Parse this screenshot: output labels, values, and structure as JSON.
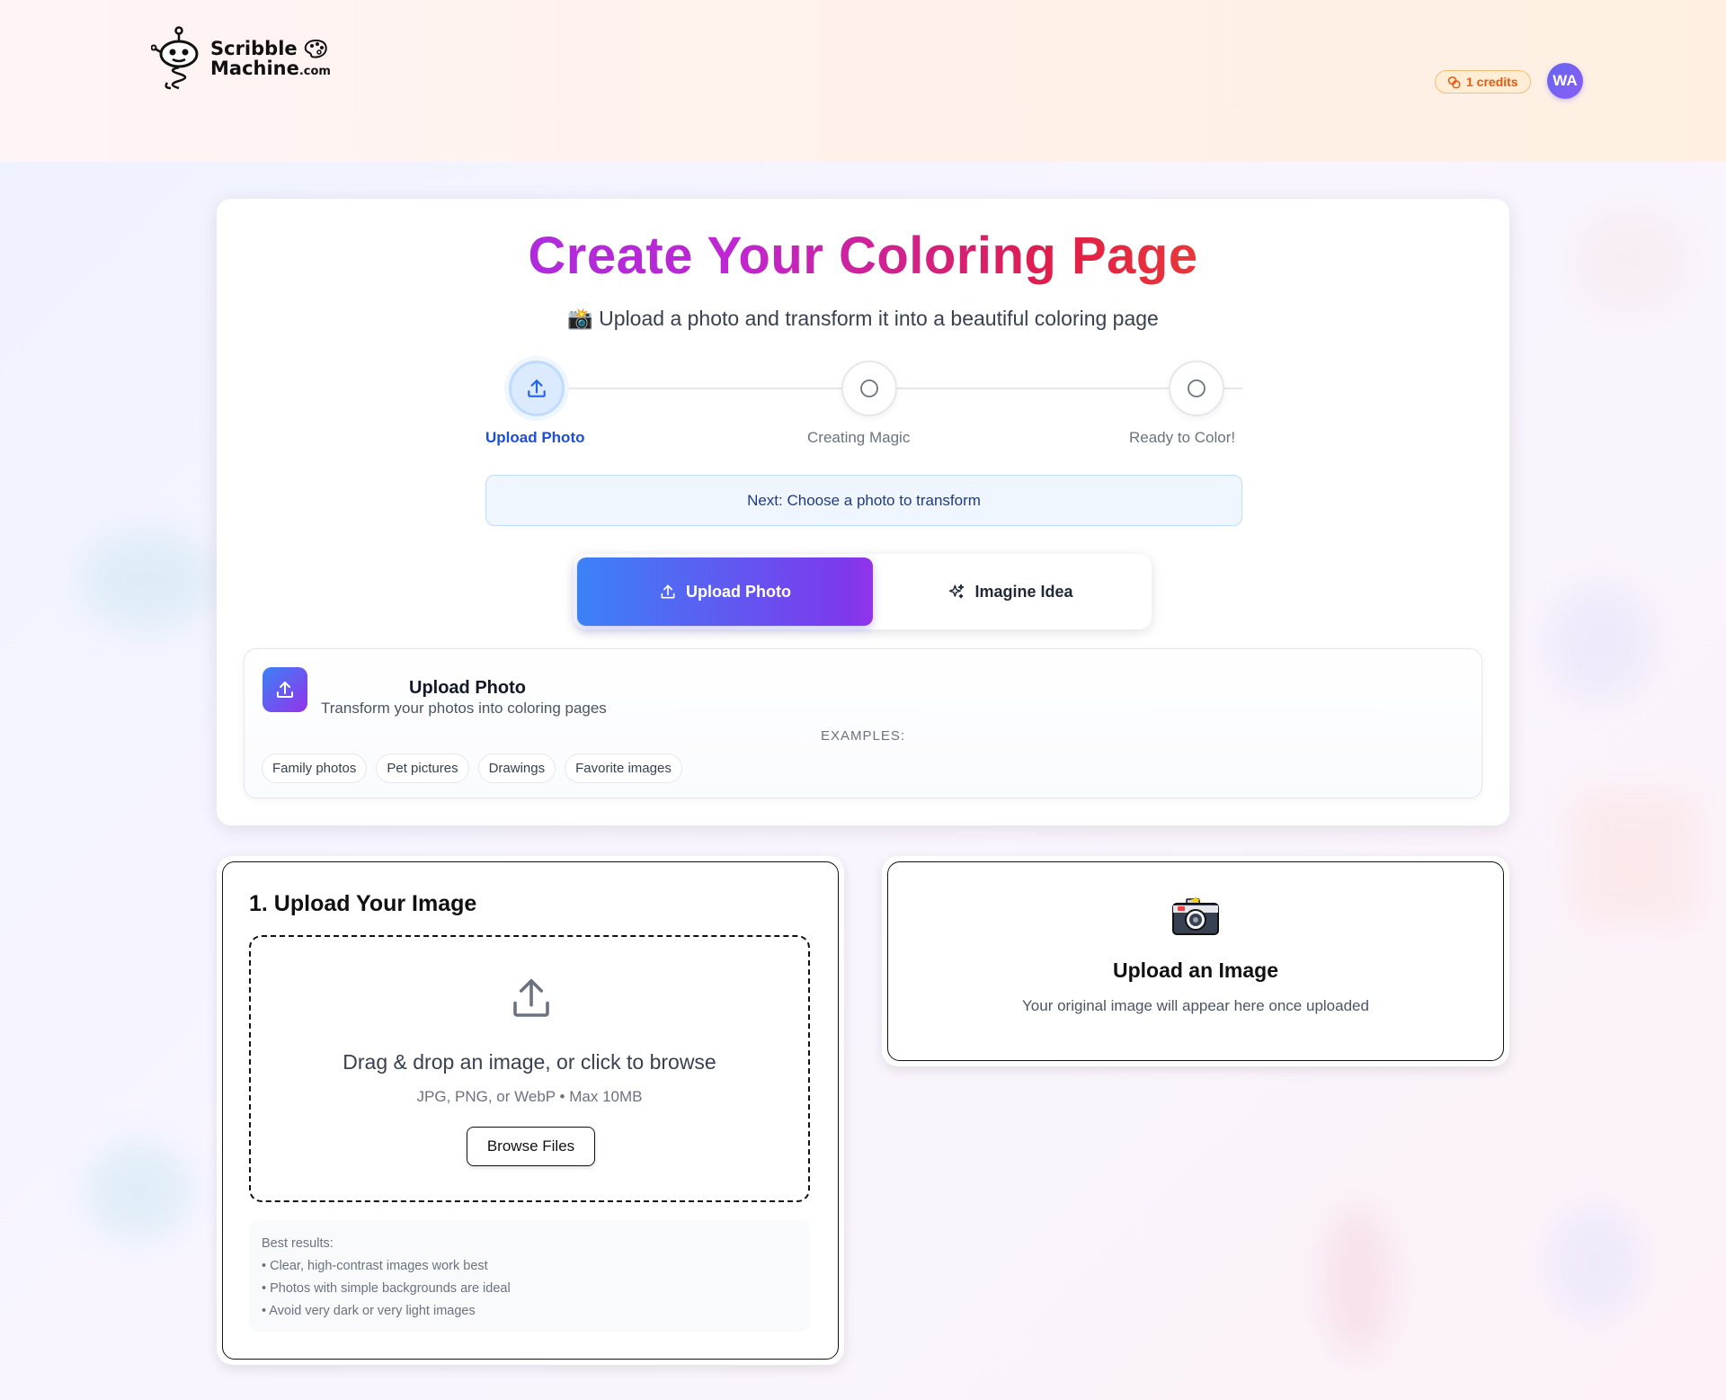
{
  "header": {
    "logo_line1": "Scribble",
    "logo_line2": "Machine",
    "logo_suffix": ".com",
    "credits": "1 credits",
    "avatar_initials": "WA"
  },
  "main": {
    "title": "Create Your Coloring Page",
    "subtitle": "📸 Upload a photo and transform it into a beautiful coloring page",
    "steps": [
      {
        "label": "Upload Photo",
        "state": "active"
      },
      {
        "label": "Creating Magic",
        "state": "pending"
      },
      {
        "label": "Ready to Color!",
        "state": "pending"
      }
    ],
    "next_hint": "Next: Choose a photo to transform",
    "modes": [
      {
        "label": "Upload Photo",
        "icon": "upload-icon",
        "active": true
      },
      {
        "label": "Imagine Idea",
        "icon": "sparkles-icon",
        "active": false
      }
    ],
    "info": {
      "title": "Upload Photo",
      "description": "Transform your photos into coloring pages",
      "examples_label": "EXAMPLES:",
      "examples": [
        "Family photos",
        "Pet pictures",
        "Drawings",
        "Favorite images"
      ]
    }
  },
  "upload": {
    "heading": "1. Upload Your Image",
    "drop_text": "Drag & drop an image, or click to browse",
    "drop_sub": "JPG, PNG, or WebP • Max 10MB",
    "browse_label": "Browse Files",
    "tips_title": "Best results:",
    "tips": [
      "• Clear, high-contrast images work best",
      "• Photos with simple backgrounds are ideal",
      "• Avoid very dark or very light images"
    ]
  },
  "preview": {
    "icon": "📸",
    "title": "Upload an Image",
    "subtitle": "Your original image will appear here once uploaded"
  },
  "colors": {
    "accent_blue": "#3b82f6",
    "accent_purple": "#9333ea",
    "credits_orange": "#ea580c"
  }
}
